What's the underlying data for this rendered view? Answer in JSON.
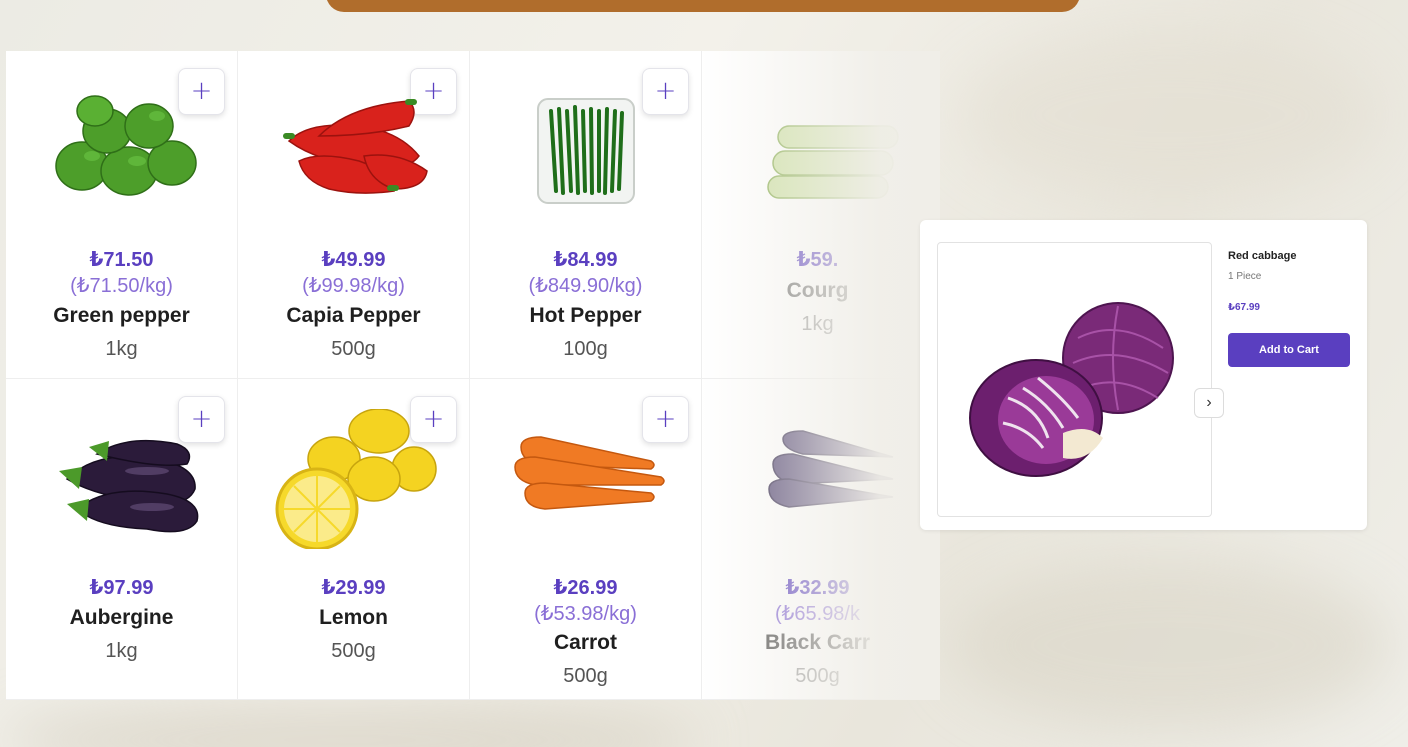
{
  "colors": {
    "accent": "#5a3fc0",
    "accent_light": "#8a6fd6",
    "top_bar": "#b06d2c"
  },
  "products": [
    {
      "price": "₺71.50",
      "unit_price": "(₺71.50/kg)",
      "name": "Green pepper",
      "weight": "1kg",
      "image": "green-pepper-icon"
    },
    {
      "price": "₺49.99",
      "unit_price": "(₺99.98/kg)",
      "name": "Capia Pepper",
      "weight": "500g",
      "image": "red-pepper-icon"
    },
    {
      "price": "₺84.99",
      "unit_price": "(₺849.90/kg)",
      "name": "Hot Pepper",
      "weight": "100g",
      "image": "hot-pepper-icon"
    },
    {
      "price": "₺59.",
      "unit_price": "",
      "name": "Courg",
      "weight": "1kg",
      "image": "courgette-icon"
    },
    {
      "price": "₺97.99",
      "unit_price": "",
      "name": "Aubergine",
      "weight": "1kg",
      "image": "aubergine-icon"
    },
    {
      "price": "₺29.99",
      "unit_price": "",
      "name": "Lemon",
      "weight": "500g",
      "image": "lemon-icon"
    },
    {
      "price": "₺26.99",
      "unit_price": "(₺53.98/kg)",
      "name": "Carrot",
      "weight": "500g",
      "image": "carrot-icon"
    },
    {
      "price": "₺32.99",
      "unit_price": "(₺65.98/k",
      "name": "Black Carr",
      "weight": "500g",
      "image": "black-carrot-icon"
    }
  ],
  "add_button_label": "+",
  "detail": {
    "name": "Red cabbage",
    "quantity": "1 Piece",
    "price": "₺67.99",
    "add_to_cart_label": "Add to Cart",
    "next_label": "›",
    "image": "red-cabbage-icon"
  }
}
